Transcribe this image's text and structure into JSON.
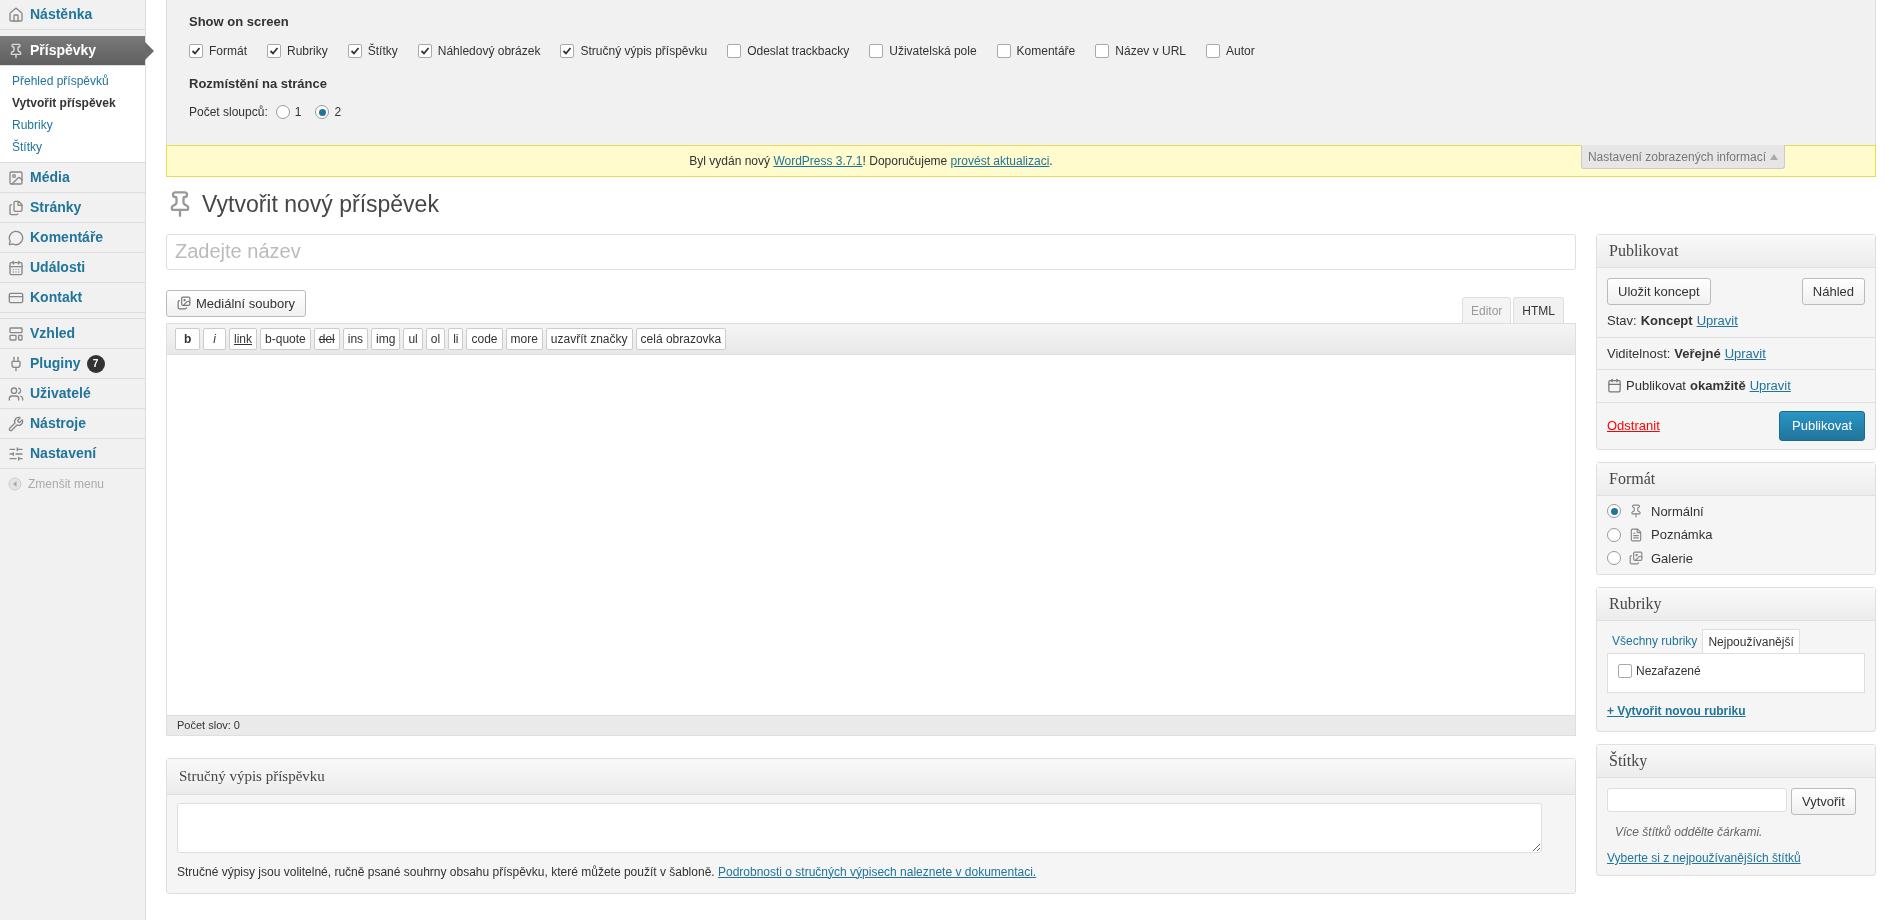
{
  "sidebar": {
    "items": [
      {
        "label": "Nástěnka",
        "selected": false
      },
      {
        "label": "Příspěvky",
        "selected": true,
        "children": [
          {
            "label": "Přehled příspěvků",
            "selected": false
          },
          {
            "label": "Vytvořit příspěvek",
            "selected": true
          },
          {
            "label": "Rubriky",
            "selected": false
          },
          {
            "label": "Štítky",
            "selected": false
          }
        ]
      },
      {
        "label": "Média",
        "selected": false
      },
      {
        "label": "Stránky",
        "selected": false
      },
      {
        "label": "Komentáře",
        "selected": false
      },
      {
        "label": "Události",
        "selected": false
      },
      {
        "label": "Kontakt",
        "selected": false
      },
      {
        "label": "Vzhled",
        "selected": false
      },
      {
        "label": "Pluginy",
        "selected": false,
        "badge": "7"
      },
      {
        "label": "Uživatelé",
        "selected": false
      },
      {
        "label": "Nástroje",
        "selected": false
      },
      {
        "label": "Nastavení",
        "selected": false
      }
    ],
    "collapse": "Zmenšit menu"
  },
  "screen_options": {
    "title": "Show on screen",
    "checkboxes": [
      {
        "label": "Formát",
        "checked": true
      },
      {
        "label": "Rubriky",
        "checked": true
      },
      {
        "label": "Štítky",
        "checked": true
      },
      {
        "label": "Náhledový obrázek",
        "checked": true
      },
      {
        "label": "Stručný výpis příspěvku",
        "checked": true
      },
      {
        "label": "Odeslat trackbacky",
        "checked": false
      },
      {
        "label": "Uživatelská pole",
        "checked": false
      },
      {
        "label": "Komentáře",
        "checked": false
      },
      {
        "label": "Název v URL",
        "checked": false
      },
      {
        "label": "Autor",
        "checked": false
      }
    ],
    "layout_title": "Rozmístění na stránce",
    "columns_label": "Počet sloupců:",
    "columns": [
      {
        "label": "1",
        "selected": false
      },
      {
        "label": "2",
        "selected": true
      }
    ],
    "toggle": {
      "label": "Nastavení zobrazených informací",
      "expanded": true
    }
  },
  "notice": {
    "text_1": "Byl vydán nový",
    "link_1": "WordPress 3.7.1",
    "text_2": "! Doporučujeme",
    "link_2": "provést aktualizaci",
    "text_3": "."
  },
  "page_title": "Vytvořit nový příspěvek",
  "title_field": {
    "placeholder": "Zadejte název"
  },
  "editor": {
    "media_button": "Mediální soubory",
    "tabs": [
      {
        "label": "Editor",
        "selected": false
      },
      {
        "label": "HTML",
        "selected": true
      }
    ],
    "toolbar": [
      {
        "label": "b",
        "kind": "bold"
      },
      {
        "label": "i",
        "kind": "italic"
      },
      {
        "label": "link",
        "kind": "link"
      },
      {
        "label": "b-quote",
        "kind": "plain"
      },
      {
        "label": "del",
        "kind": "del"
      },
      {
        "label": "ins",
        "kind": "plain"
      },
      {
        "label": "img",
        "kind": "plain"
      },
      {
        "label": "ul",
        "kind": "plain"
      },
      {
        "label": "ol",
        "kind": "plain"
      },
      {
        "label": "li",
        "kind": "plain"
      },
      {
        "label": "code",
        "kind": "plain"
      },
      {
        "label": "more",
        "kind": "plain"
      },
      {
        "label": "uzavřít značky",
        "kind": "plain"
      },
      {
        "label": "celá obrazovka",
        "kind": "plain"
      }
    ],
    "word_count": "Počet slov: 0"
  },
  "excerpt": {
    "title": "Stručný výpis příspěvku",
    "help": "Stručné výpisy jsou volitelné, ručně psané souhrny obsahu příspěvku, které můžete použít v šabloně.",
    "help_link": "Podrobnosti o stručných výpisech naleznete v dokumentaci."
  },
  "publish": {
    "title": "Publikovat",
    "save_draft": "Uložit koncept",
    "preview": "Náhled",
    "rows": [
      {
        "label": "Stav:",
        "value": "Koncept",
        "link": "Upravit"
      },
      {
        "label": "Viditelnost:",
        "value": "Veřejné",
        "link": "Upravit"
      },
      {
        "label": "Publikovat",
        "value": "okamžitě",
        "link": "Upravit"
      }
    ],
    "delete": "Odstranit",
    "publish": "Publikovat"
  },
  "format": {
    "title": "Formát",
    "options": [
      {
        "label": "Normální",
        "selected": true
      },
      {
        "label": "Poznámka",
        "selected": false
      },
      {
        "label": "Galerie",
        "selected": false
      }
    ]
  },
  "categories": {
    "title": "Rubriky",
    "tabs": [
      {
        "label": "Všechny rubriky",
        "selected": false
      },
      {
        "label": "Nejpoužívanější",
        "selected": true
      }
    ],
    "items": [
      {
        "label": "Nezařazené",
        "checked": false
      }
    ],
    "add_link": "+ Vytvořit novou rubriku"
  },
  "tags": {
    "title": "Štítky",
    "add_button": "Vytvořit",
    "hint": "Více štítků oddělte čárkami.",
    "link": "Vyberte si z nejpoužívanějších štítků"
  }
}
